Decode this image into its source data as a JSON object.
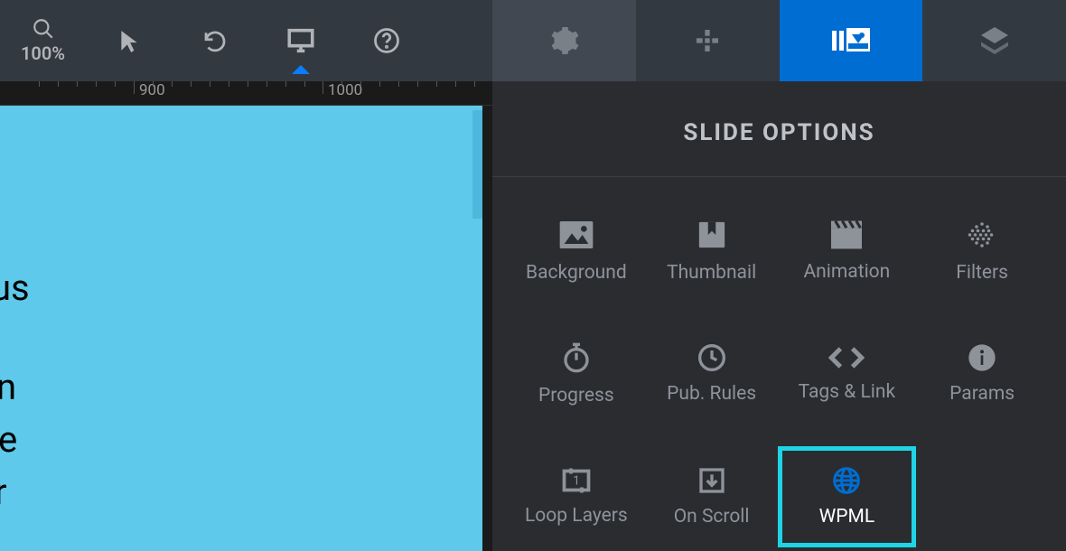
{
  "toolbar": {
    "zoom_label": "100%"
  },
  "ruler": {
    "marks": [
      {
        "value": "900",
        "pos": 148
      },
      {
        "value": "1000",
        "pos": 357
      }
    ]
  },
  "canvas": {
    "text_fragments": [
      "us",
      "n",
      "e",
      "r"
    ]
  },
  "panel": {
    "title": "SLIDE OPTIONS",
    "items": [
      {
        "label": "Background",
        "icon": "image-icon"
      },
      {
        "label": "Thumbnail",
        "icon": "bookmark-icon"
      },
      {
        "label": "Animation",
        "icon": "clapper-icon"
      },
      {
        "label": "Filters",
        "icon": "dots-icon"
      },
      {
        "label": "Progress",
        "icon": "stopwatch-icon"
      },
      {
        "label": "Pub. Rules",
        "icon": "clock-icon"
      },
      {
        "label": "Tags & Link",
        "icon": "code-icon"
      },
      {
        "label": "Params",
        "icon": "info-icon"
      },
      {
        "label": "Loop Layers",
        "icon": "loop-icon"
      },
      {
        "label": "On Scroll",
        "icon": "download-box-icon"
      },
      {
        "label": "WPML",
        "icon": "globe-icon",
        "highlight": true
      }
    ]
  }
}
